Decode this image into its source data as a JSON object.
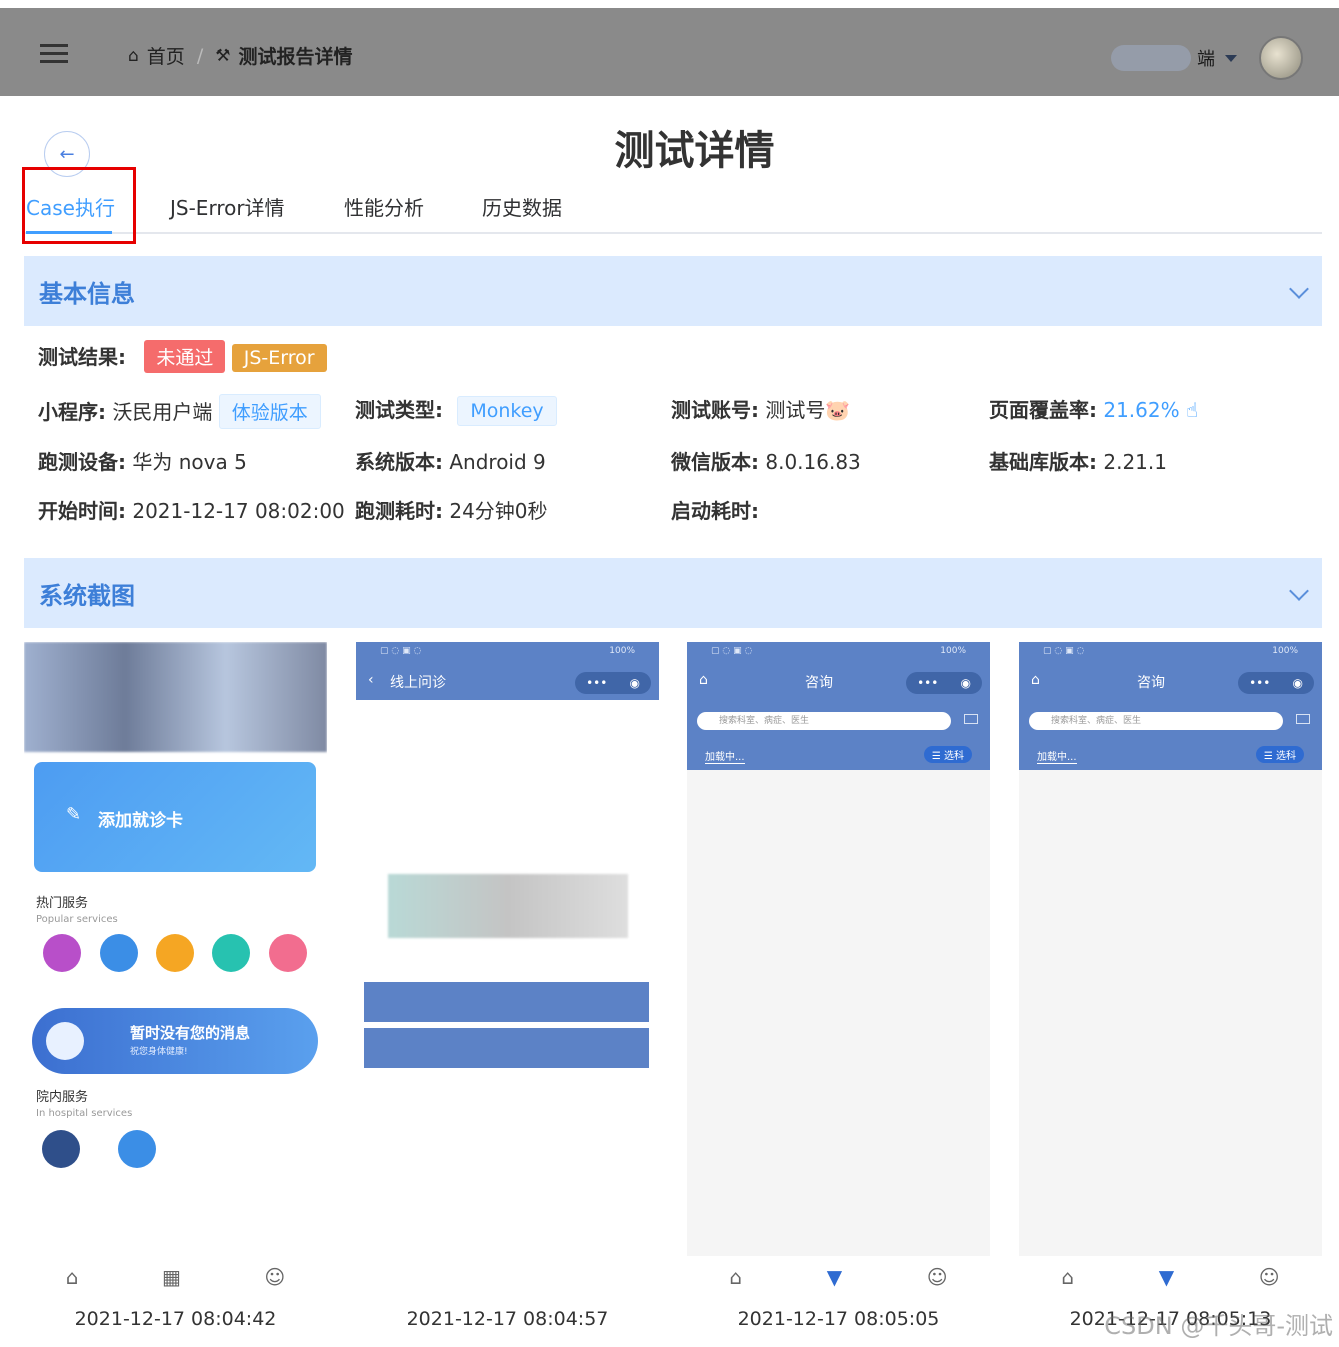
{
  "topbar": {
    "breadcrumb_home": "首页",
    "breadcrumb_sep": "/",
    "breadcrumb_current": "测试报告详情",
    "user_label": "端"
  },
  "page": {
    "title": "测试详情",
    "back_icon": "←"
  },
  "tabs": [
    {
      "label": "Case执行",
      "active": true
    },
    {
      "label": "JS-Error详情",
      "active": false
    },
    {
      "label": "性能分析",
      "active": false
    },
    {
      "label": "历史数据",
      "active": false
    }
  ],
  "basic_info": {
    "title": "基本信息",
    "result_label": "测试结果:",
    "result_tags": [
      "未通过",
      "JS-Error"
    ],
    "miniprogram_label": "小程序:",
    "miniprogram_value": "沃民用户端",
    "version_tag": "体验版本",
    "test_type_label": "测试类型:",
    "test_type_value": "Monkey",
    "account_label": "测试账号:",
    "account_value": "测试号",
    "account_emoji": "🐷",
    "coverage_label": "页面覆盖率:",
    "coverage_value": "21.62%",
    "device_label": "跑测设备:",
    "device_value": "华为 nova 5",
    "os_label": "系统版本:",
    "os_value": "Android 9",
    "wechat_label": "微信版本:",
    "wechat_value": "8.0.16.83",
    "lib_label": "基础库版本:",
    "lib_value": "2.21.1",
    "start_label": "开始时间:",
    "start_value": "2021-12-17 08:02:00",
    "duration_label": "跑测耗时:",
    "duration_value": "24分钟0秒",
    "launch_label": "启动耗时:",
    "launch_value": ""
  },
  "screenshots": {
    "title": "系统截图",
    "items": [
      {
        "time": "2021-12-17 08:04:42",
        "add_card": "添加就诊卡",
        "hot_services": "热门服务",
        "hot_services_en": "Popular services",
        "no_msg": "暂时没有您的消息",
        "no_msg_sub": "祝您身体健康!",
        "in_hospital": "院内服务",
        "in_hospital_en": "In hospital services"
      },
      {
        "time": "2021-12-17 08:04:57",
        "nav_title": "线上问诊"
      },
      {
        "time": "2021-12-17 08:05:05",
        "nav_title": "咨询",
        "search_placeholder": "搜索科室、病症、医生",
        "loading": "加载中...",
        "select_dept": "☰ 选科"
      },
      {
        "time": "2021-12-17 08:05:13",
        "nav_title": "咨询",
        "search_placeholder": "搜索科室、病症、医生",
        "loading": "加载中...",
        "select_dept": "☰ 选科"
      }
    ]
  },
  "watermark": "CSDN @千头哥-测试"
}
